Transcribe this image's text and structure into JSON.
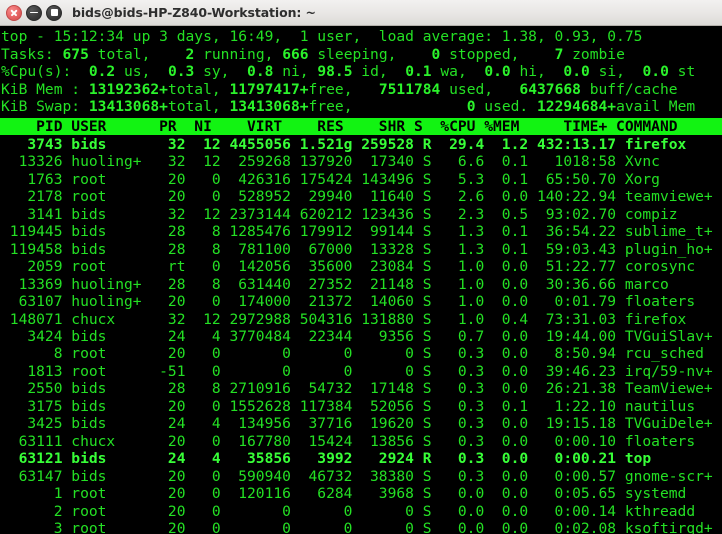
{
  "window": {
    "title": "bids@bids-HP-Z840-Workstation: ~",
    "buttons": [
      {
        "name": "close",
        "label": "Close"
      },
      {
        "name": "minimize",
        "label": "Minimize"
      },
      {
        "name": "maximize",
        "label": "Maximize"
      }
    ]
  },
  "colors": {
    "terminal_bg": "#000000",
    "terminal_fg": "#24e024",
    "terminal_bold_fg": "#38ff38",
    "header_bar_bg": "#12f312",
    "header_bar_fg": "#000000",
    "titlebar_bg": "#e8e6e4",
    "titlebar_fg": "#2e2e2e",
    "close_button": "#e35f5f"
  },
  "summary": {
    "uptime_line": {
      "program": "top",
      "time": "15:12:34",
      "up": "3 days, 16:49",
      "users": "1 user",
      "load_average": [
        "1.38",
        "0.93",
        "0.75"
      ],
      "text": "top - 15:12:34 up 3 days, 16:49,  1 user,  load average: 1.38, 0.93, 0.75"
    },
    "tasks_line": {
      "label": "Tasks:",
      "total": "675",
      "running": "2",
      "sleeping": "666",
      "stopped": "0",
      "zombie": "7"
    },
    "cpu_line": {
      "label": "%Cpu(s):",
      "us": "0.2",
      "sy": "0.3",
      "ni": "0.8",
      "id": "98.5",
      "wa": "0.1",
      "hi": "0.0",
      "si": "0.0",
      "st": "0.0"
    },
    "mem_line": {
      "label": "KiB Mem :",
      "total": "13192362+",
      "free": "11797417+",
      "used": "7511784",
      "buff_cache": "6437668"
    },
    "swap_line": {
      "label": "KiB Swap:",
      "total": "13413068+",
      "free": "13413068+",
      "used": "0",
      "avail_mem": "12294684+"
    }
  },
  "table": {
    "columns": [
      "PID",
      "USER",
      "PR",
      "NI",
      "VIRT",
      "RES",
      "SHR",
      "S",
      "%CPU",
      "%MEM",
      "TIME+",
      "COMMAND"
    ],
    "header_text": "    PID USER      PR  NI    VIRT    RES    SHR S  %CPU %MEM     TIME+ COMMAND",
    "rows": [
      {
        "pid": "3743",
        "user": "bids",
        "pr": "32",
        "ni": "12",
        "virt": "4455056",
        "res": "1.521g",
        "shr": "259528",
        "s": "R",
        "cpu": "29.4",
        "mem": "1.2",
        "time": "432:13.17",
        "command": "firefox",
        "highlight": true
      },
      {
        "pid": "13326",
        "user": "huoling+",
        "pr": "32",
        "ni": "12",
        "virt": "259268",
        "res": "137920",
        "shr": "17340",
        "s": "S",
        "cpu": "6.6",
        "mem": "0.1",
        "time": "1018:58",
        "command": "Xvnc",
        "highlight": false
      },
      {
        "pid": "1763",
        "user": "root",
        "pr": "20",
        "ni": "0",
        "virt": "426316",
        "res": "175424",
        "shr": "143496",
        "s": "S",
        "cpu": "5.3",
        "mem": "0.1",
        "time": "65:50.70",
        "command": "Xorg",
        "highlight": false
      },
      {
        "pid": "2178",
        "user": "root",
        "pr": "20",
        "ni": "0",
        "virt": "528952",
        "res": "29940",
        "shr": "11640",
        "s": "S",
        "cpu": "2.6",
        "mem": "0.0",
        "time": "140:22.94",
        "command": "teamviewe+",
        "highlight": false
      },
      {
        "pid": "3141",
        "user": "bids",
        "pr": "32",
        "ni": "12",
        "virt": "2373144",
        "res": "620212",
        "shr": "123436",
        "s": "S",
        "cpu": "2.3",
        "mem": "0.5",
        "time": "93:02.70",
        "command": "compiz",
        "highlight": false
      },
      {
        "pid": "119445",
        "user": "bids",
        "pr": "28",
        "ni": "8",
        "virt": "1285476",
        "res": "179912",
        "shr": "99144",
        "s": "S",
        "cpu": "1.3",
        "mem": "0.1",
        "time": "36:54.22",
        "command": "sublime_t+",
        "highlight": false
      },
      {
        "pid": "119458",
        "user": "bids",
        "pr": "28",
        "ni": "8",
        "virt": "781100",
        "res": "67000",
        "shr": "13328",
        "s": "S",
        "cpu": "1.3",
        "mem": "0.1",
        "time": "59:03.43",
        "command": "plugin_ho+",
        "highlight": false
      },
      {
        "pid": "2059",
        "user": "root",
        "pr": "rt",
        "ni": "0",
        "virt": "142056",
        "res": "35600",
        "shr": "23084",
        "s": "S",
        "cpu": "1.0",
        "mem": "0.0",
        "time": "51:22.77",
        "command": "corosync",
        "highlight": false
      },
      {
        "pid": "13369",
        "user": "huoling+",
        "pr": "28",
        "ni": "8",
        "virt": "631440",
        "res": "27352",
        "shr": "21148",
        "s": "S",
        "cpu": "1.0",
        "mem": "0.0",
        "time": "30:36.66",
        "command": "marco",
        "highlight": false
      },
      {
        "pid": "63107",
        "user": "huoling+",
        "pr": "20",
        "ni": "0",
        "virt": "174000",
        "res": "21372",
        "shr": "14060",
        "s": "S",
        "cpu": "1.0",
        "mem": "0.0",
        "time": "0:01.79",
        "command": "floaters",
        "highlight": false
      },
      {
        "pid": "148071",
        "user": "chucx",
        "pr": "32",
        "ni": "12",
        "virt": "2972988",
        "res": "504316",
        "shr": "131880",
        "s": "S",
        "cpu": "1.0",
        "mem": "0.4",
        "time": "73:31.03",
        "command": "firefox",
        "highlight": false
      },
      {
        "pid": "3424",
        "user": "bids",
        "pr": "24",
        "ni": "4",
        "virt": "3770484",
        "res": "22344",
        "shr": "9356",
        "s": "S",
        "cpu": "0.7",
        "mem": "0.0",
        "time": "19:44.00",
        "command": "TVGuiSlav+",
        "highlight": false
      },
      {
        "pid": "8",
        "user": "root",
        "pr": "20",
        "ni": "0",
        "virt": "0",
        "res": "0",
        "shr": "0",
        "s": "S",
        "cpu": "0.3",
        "mem": "0.0",
        "time": "8:50.94",
        "command": "rcu_sched",
        "highlight": false
      },
      {
        "pid": "1813",
        "user": "root",
        "pr": "-51",
        "ni": "0",
        "virt": "0",
        "res": "0",
        "shr": "0",
        "s": "S",
        "cpu": "0.3",
        "mem": "0.0",
        "time": "39:46.23",
        "command": "irq/59-nv+",
        "highlight": false
      },
      {
        "pid": "2550",
        "user": "bids",
        "pr": "28",
        "ni": "8",
        "virt": "2710916",
        "res": "54732",
        "shr": "17148",
        "s": "S",
        "cpu": "0.3",
        "mem": "0.0",
        "time": "26:21.38",
        "command": "TeamViewe+",
        "highlight": false
      },
      {
        "pid": "3175",
        "user": "bids",
        "pr": "20",
        "ni": "0",
        "virt": "1552628",
        "res": "117384",
        "shr": "52056",
        "s": "S",
        "cpu": "0.3",
        "mem": "0.1",
        "time": "1:22.10",
        "command": "nautilus",
        "highlight": false
      },
      {
        "pid": "3425",
        "user": "bids",
        "pr": "24",
        "ni": "4",
        "virt": "134956",
        "res": "37716",
        "shr": "19620",
        "s": "S",
        "cpu": "0.3",
        "mem": "0.0",
        "time": "19:15.18",
        "command": "TVGuiDele+",
        "highlight": false
      },
      {
        "pid": "63111",
        "user": "chucx",
        "pr": "20",
        "ni": "0",
        "virt": "167780",
        "res": "15424",
        "shr": "13856",
        "s": "S",
        "cpu": "0.3",
        "mem": "0.0",
        "time": "0:00.10",
        "command": "floaters",
        "highlight": false
      },
      {
        "pid": "63121",
        "user": "bids",
        "pr": "24",
        "ni": "4",
        "virt": "35856",
        "res": "3992",
        "shr": "2924",
        "s": "R",
        "cpu": "0.3",
        "mem": "0.0",
        "time": "0:00.21",
        "command": "top",
        "highlight": true
      },
      {
        "pid": "63147",
        "user": "bids",
        "pr": "20",
        "ni": "0",
        "virt": "590940",
        "res": "46732",
        "shr": "38380",
        "s": "S",
        "cpu": "0.3",
        "mem": "0.0",
        "time": "0:00.57",
        "command": "gnome-scr+",
        "highlight": false
      },
      {
        "pid": "1",
        "user": "root",
        "pr": "20",
        "ni": "0",
        "virt": "120116",
        "res": "6284",
        "shr": "3968",
        "s": "S",
        "cpu": "0.0",
        "mem": "0.0",
        "time": "0:05.65",
        "command": "systemd",
        "highlight": false
      },
      {
        "pid": "2",
        "user": "root",
        "pr": "20",
        "ni": "0",
        "virt": "0",
        "res": "0",
        "shr": "0",
        "s": "S",
        "cpu": "0.0",
        "mem": "0.0",
        "time": "0:00.14",
        "command": "kthreadd",
        "highlight": false
      },
      {
        "pid": "3",
        "user": "root",
        "pr": "20",
        "ni": "0",
        "virt": "0",
        "res": "0",
        "shr": "0",
        "s": "S",
        "cpu": "0.0",
        "mem": "0.0",
        "time": "0:02.08",
        "command": "ksoftirqd+",
        "highlight": false
      }
    ]
  }
}
